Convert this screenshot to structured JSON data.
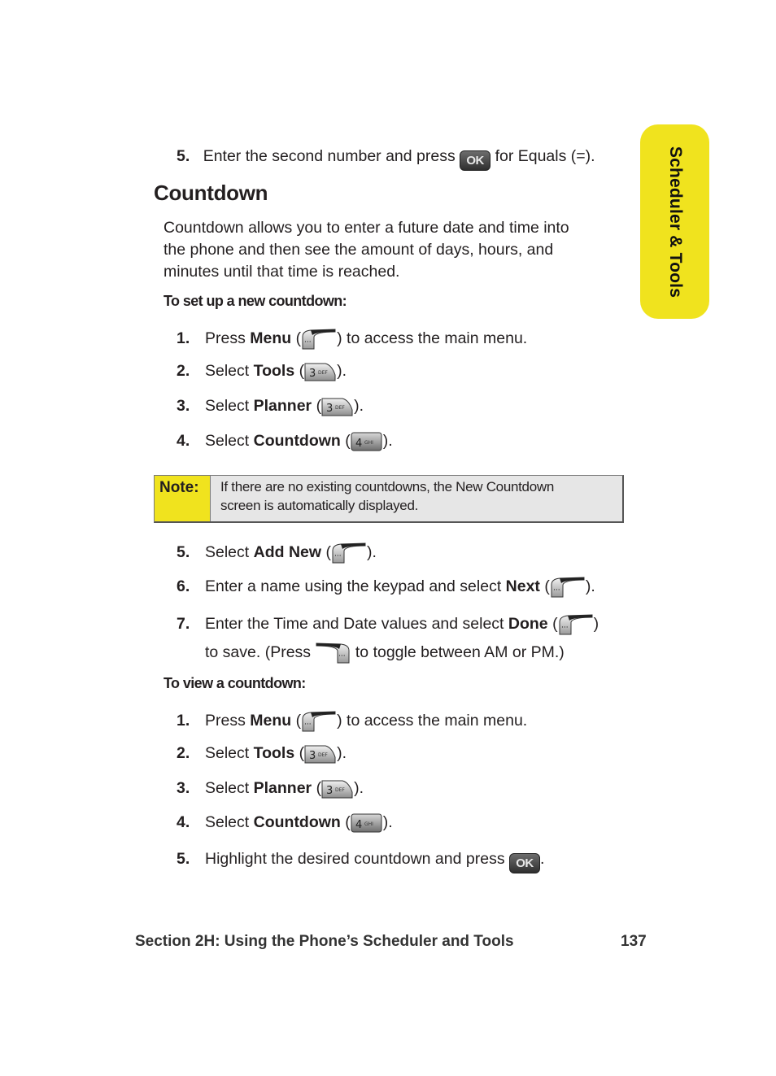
{
  "side_tab": {
    "label": "Scheduler & Tools",
    "color": "#f0e31e"
  },
  "intro_step": {
    "number": "5.",
    "before": "Enter the second number and press",
    "key": "OK",
    "after": "for Equals (=)."
  },
  "heading": "Countdown",
  "description": "Countdown allows you to enter a future date and time into the phone and then see the amount of days, hours, and minutes until that time is reached.",
  "description_lines": [
    "Countdown allows you to enter a future date and time into",
    "the phone and then see the amount of days, hours, and",
    "minutes until that time is reached."
  ],
  "setup": {
    "title": "To set up a new countdown:",
    "steps": [
      {
        "number": "1.",
        "pre": "Press",
        "bold": "Menu",
        "open": "(",
        "key": "left-softkey",
        "close": ") to access the main menu."
      },
      {
        "number": "2.",
        "pre": "Select",
        "bold": "Tools",
        "open": "(",
        "key": "3",
        "key_sub": "DEF",
        "close": ")."
      },
      {
        "number": "3.",
        "pre": "Select",
        "bold": "Planner",
        "open": "(",
        "key": "3",
        "key_sub": "DEF",
        "close": ")."
      },
      {
        "number": "4.",
        "pre": "Select",
        "bold": "Countdown",
        "open": "(",
        "key": "4",
        "key_sub": "GHI",
        "close": ")."
      }
    ],
    "steps_after_note": [
      {
        "number": "5.",
        "pre": "Select",
        "bold": "Add New",
        "open": "(",
        "key": "left-softkey",
        "close": ")."
      },
      {
        "number": "6.",
        "pre": "Enter a name using the keypad and select",
        "bold": "Next",
        "open": "(",
        "key": "left-softkey",
        "close": ")."
      },
      {
        "number": "7.",
        "pre": "Enter the Time and Date values and select",
        "bold": "Done",
        "open": "(",
        "key": "left-softkey",
        "close": ")",
        "line2_pre": "to save. (Press",
        "line2_key": "right-softkey",
        "line2_post": "to toggle between AM or PM.)"
      }
    ]
  },
  "note": {
    "label": "Note:",
    "text_lines": [
      "If there are no existing countdowns, the New Countdown",
      "screen is automatically displayed."
    ]
  },
  "view": {
    "title": "To view a countdown:",
    "steps": [
      {
        "number": "1.",
        "pre": "Press",
        "bold": "Menu",
        "open": "(",
        "key": "left-softkey",
        "close": ") to access the main menu."
      },
      {
        "number": "2.",
        "pre": "Select",
        "bold": "Tools",
        "open": "(",
        "key": "3",
        "key_sub": "DEF",
        "close": ")."
      },
      {
        "number": "3.",
        "pre": "Select",
        "bold": "Planner",
        "open": "(",
        "key": "3",
        "key_sub": "DEF",
        "close": ")."
      },
      {
        "number": "4.",
        "pre": "Select",
        "bold": "Countdown",
        "open": "(",
        "key": "4",
        "key_sub": "GHI",
        "close": ")."
      },
      {
        "number": "5.",
        "pre": "Highlight the desired countdown and press",
        "key": "OK",
        "close": "."
      }
    ]
  },
  "footer": {
    "section": "Section 2H: Using the Phone’s Scheduler and Tools",
    "page": "137"
  }
}
